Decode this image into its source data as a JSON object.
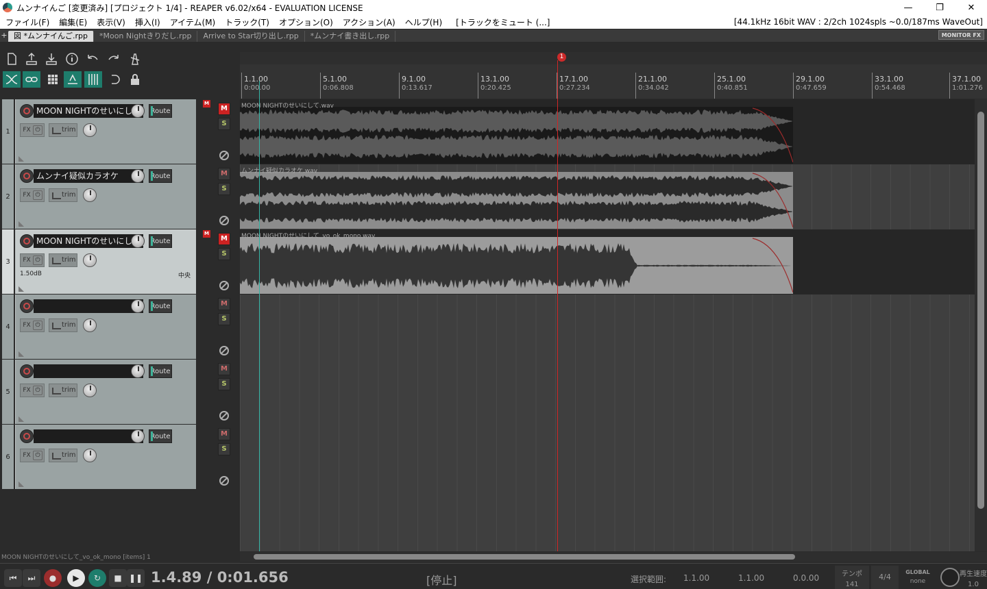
{
  "window": {
    "title": "ムンナイんご [変更済み] [プロジェクト 1/4] - REAPER v6.02/x64 - EVALUATION LICENSE",
    "minimize": "—",
    "maximize": "❐",
    "close": "✕"
  },
  "menu": {
    "items": [
      "ファイル(F)",
      "編集(E)",
      "表示(V)",
      "挿入(I)",
      "アイテム(M)",
      "トラック(T)",
      "オプション(O)",
      "アクション(A)",
      "ヘルプ(H)",
      "[トラックをミュート (...]"
    ],
    "status": "[44.1kHz 16bit WAV : 2/2ch 1024spls ~0.0/187ms WaveOut]"
  },
  "tabs": {
    "plus": "+",
    "items": [
      "図 *ムンナイんご.rpp",
      "*Moon Nightきりだし.rpp",
      "Arrive to Star切り出し.rpp",
      "*ムンナイ書き出し.rpp"
    ],
    "monitor_fx": "MONITOR FX"
  },
  "ruler": {
    "marker": "1",
    "ticks": [
      {
        "bar": "1.1.00",
        "time": "0:00.00"
      },
      {
        "bar": "5.1.00",
        "time": "0:06.808"
      },
      {
        "bar": "9.1.00",
        "time": "0:13.617"
      },
      {
        "bar": "13.1.00",
        "time": "0:20.425"
      },
      {
        "bar": "17.1.00",
        "time": "0:27.234"
      },
      {
        "bar": "21.1.00",
        "time": "0:34.042"
      },
      {
        "bar": "25.1.00",
        "time": "0:40.851"
      },
      {
        "bar": "29.1.00",
        "time": "0:47.659"
      },
      {
        "bar": "33.1.00",
        "time": "0:54.468"
      },
      {
        "bar": "37.1.00",
        "time": "1:01.276"
      }
    ]
  },
  "tracks": [
    {
      "num": "1",
      "name": "MOON NIGHTのせいにして",
      "route": "Route",
      "fx": "FX",
      "trim": "trim",
      "mute": "M",
      "solo": "S",
      "muted": true,
      "env_m": "M",
      "item": "MOON NIGHTのせいにして.wav",
      "vol": "",
      "pan": ""
    },
    {
      "num": "2",
      "name": "ムンナイ疑似カラオケ",
      "route": "Route",
      "fx": "FX",
      "trim": "trim",
      "mute": "M",
      "solo": "S",
      "muted": false,
      "env_m": "",
      "item": "ムンナイ疑似カラオケ.wav",
      "vol": "",
      "pan": ""
    },
    {
      "num": "3",
      "name": "MOON NIGHTのせいにして_",
      "route": "Route",
      "fx": "FX",
      "trim": "trim",
      "mute": "M",
      "solo": "S",
      "muted": true,
      "env_m": "M",
      "item": "MOON NIGHTのせいにして_vo_ok_mono.wav",
      "vol": "1.50dB",
      "pan": "中央"
    },
    {
      "num": "4",
      "name": "",
      "route": "Route",
      "fx": "FX",
      "trim": "trim",
      "mute": "M",
      "solo": "S",
      "muted": false,
      "env_m": "",
      "item": "",
      "vol": "",
      "pan": ""
    },
    {
      "num": "5",
      "name": "",
      "route": "Route",
      "fx": "FX",
      "trim": "trim",
      "mute": "M",
      "solo": "S",
      "muted": false,
      "env_m": "",
      "item": "",
      "vol": "",
      "pan": ""
    },
    {
      "num": "6",
      "name": "",
      "route": "Route",
      "fx": "FX",
      "trim": "trim",
      "mute": "M",
      "solo": "S",
      "muted": false,
      "env_m": "",
      "item": "",
      "vol": "",
      "pan": ""
    }
  ],
  "status_line": "MOON NIGHTのせいにして_vo_ok_mono [items] 1",
  "transport": {
    "position": "1.4.89 / 0:01.656",
    "state": "[停止]",
    "selection_label": "選択範囲:",
    "sel_start": "1.1.00",
    "sel_end": "1.1.00",
    "sel_len": "0.0.00",
    "tempo_label": "テンポ",
    "tempo": "141",
    "signature": "4/4",
    "global_label": "GLOBAL",
    "global_value": "none",
    "rate_label": "再生速度",
    "rate": "1.0"
  },
  "colors": {
    "accent": "#1e7d6c",
    "mute_on": "#cc2222",
    "cursor": "#d02626",
    "edit_cursor": "#35b5a6"
  }
}
